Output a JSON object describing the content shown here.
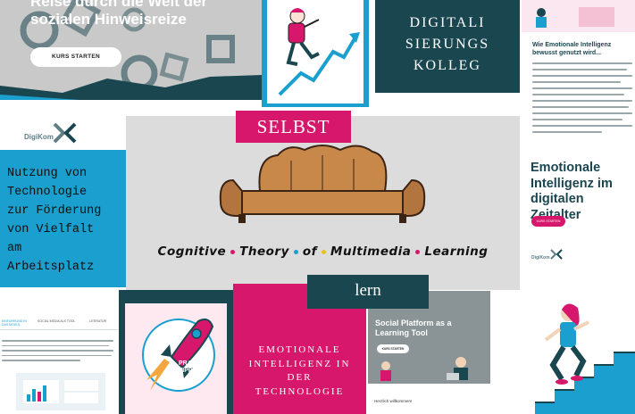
{
  "course_tile": {
    "title": "Reise durch die Welt der sozialen Hinweisreize",
    "button": "KURS STARTEN"
  },
  "college_tile": {
    "lines": [
      "DIGITALI",
      "SIERUNGS",
      "KOLLEG"
    ]
  },
  "article_tile": {
    "heading": "Wie Emotionale Intelligenz bewusst genutzt wird..."
  },
  "selbst_tile": {
    "text": "SELBST"
  },
  "sofa_tile": {
    "caption_words": [
      "Cognitive",
      "Theory",
      "of",
      "Multimedia",
      "Learning"
    ],
    "dot_colors": [
      "#d6176b",
      "#1a9fcf",
      "#e8c020",
      "#d6176b"
    ]
  },
  "logo_tile": {
    "brand": "DigiKom"
  },
  "vielfalt_tile": {
    "lines": [
      "Nutzung von",
      "Technologie",
      "zur Förderung",
      "von Vielfalt",
      "am",
      "Arbeitsplatz"
    ]
  },
  "ei_tile": {
    "heading_lines": [
      "Emotionale",
      "Intelligenz im",
      "digitalen Zeitalter"
    ],
    "button": "KURS STARTEN",
    "brand": "DigiKom"
  },
  "web_tile": {
    "tabs": [
      "EINFÜHRUNG IN DAS MODUL",
      "SOCIAL MEDIA ALS TOOL",
      "LITERATUR"
    ]
  },
  "rocket_tile": {
    "label_lines": [
      "PRAXIS-",
      "TIPP"
    ]
  },
  "eit_tile": {
    "lines": [
      "EMOTIONALE",
      "INTELLIGENZ IN",
      "DER",
      "TECHNOLOGIE"
    ]
  },
  "lern_tile": {
    "text": "lern"
  },
  "social_tile": {
    "title": "Social Platform as a Learning Tool",
    "button": "KURS STARTEN",
    "footer": "Herzlich willkommen!"
  },
  "colors": {
    "magenta": "#d6176b",
    "teal_dark": "#1a4650",
    "cyan": "#1a9fcf",
    "gray": "#dcdcdc"
  }
}
